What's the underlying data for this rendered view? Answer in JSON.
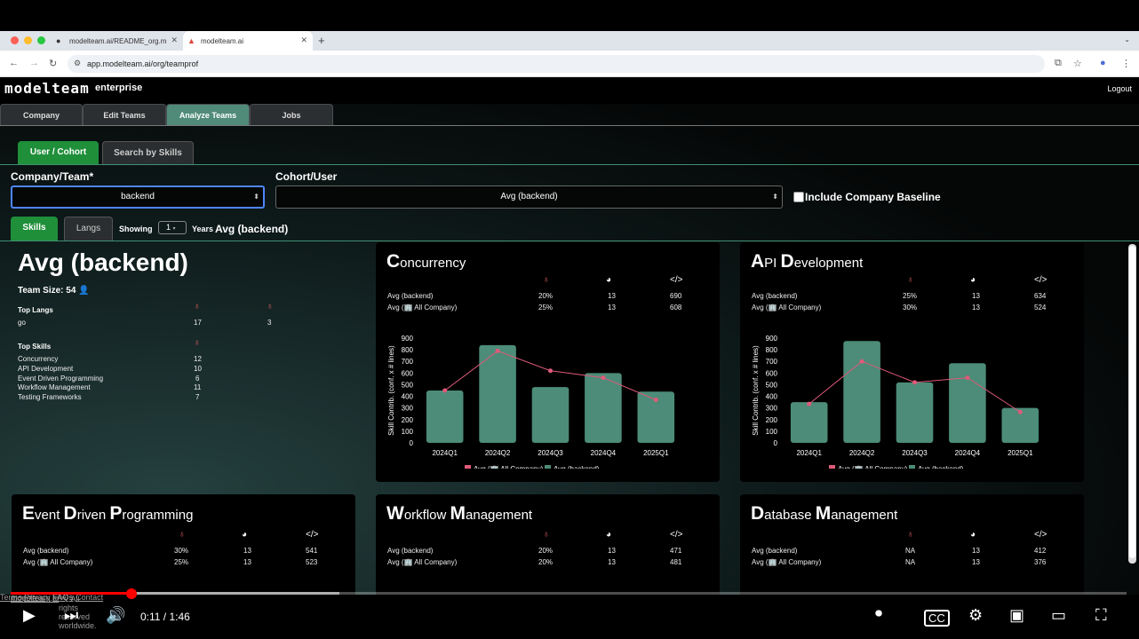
{
  "browser": {
    "tabs": [
      {
        "label": "modelteam.ai/README_org.m"
      },
      {
        "label": "modelteam.ai"
      }
    ],
    "url": "app.modelteam.ai/org/teamprof"
  },
  "app": {
    "logo": "modelteam",
    "edition": "enterprise",
    "logout": "Logout",
    "main_tabs": [
      "Company",
      "Edit Teams",
      "Analyze Teams",
      "Jobs"
    ],
    "sub_tabs": [
      "User / Cohort",
      "Search by Skills"
    ],
    "company_team_label": "Company/Team*",
    "company_team_value": "backend",
    "cohort_label": "Cohort/User",
    "cohort_value": "Avg (backend)",
    "include_baseline": "Include Company Baseline",
    "skill_tabs": [
      "Skills",
      "Langs"
    ],
    "showing_label": "Showing",
    "years_value": "1",
    "years_label": "Years",
    "selection": "Avg (backend)"
  },
  "summary": {
    "title": "Avg (backend)",
    "team_size": "Team Size: 54",
    "top_langs_label": "Top Langs",
    "langs": [
      {
        "name": "go",
        "a": "17",
        "b": "3"
      }
    ],
    "top_skills_label": "Top Skills",
    "skills": [
      {
        "name": "Concurrency",
        "v": "12"
      },
      {
        "name": "API Development",
        "v": "10"
      },
      {
        "name": "Event Driven Programming",
        "v": "6"
      },
      {
        "name": "Workflow Management",
        "v": "11"
      },
      {
        "name": "Testing Frameworks",
        "v": "7"
      }
    ]
  },
  "cards": [
    {
      "cap1": "C",
      "rest1": "oncurrency",
      "cap2": "",
      "rest2": "",
      "rows": [
        {
          "name": "Avg (backend)",
          "a": "20%",
          "b": "13",
          "c": "690"
        },
        {
          "name": "Avg (🏢 All Company)",
          "a": "25%",
          "b": "13",
          "c": "608"
        }
      ]
    },
    {
      "cap1": "A",
      "rest1": "PI ",
      "cap2": "D",
      "rest2": "evelopment",
      "rows": [
        {
          "name": "Avg (backend)",
          "a": "25%",
          "b": "13",
          "c": "634"
        },
        {
          "name": "Avg (🏢 All Company)",
          "a": "30%",
          "b": "13",
          "c": "524"
        }
      ]
    },
    {
      "cap1": "E",
      "rest1": "vent ",
      "cap2": "D",
      "rest2": "riven ",
      "cap3": "P",
      "rest3": "rogramming",
      "rows": [
        {
          "name": "Avg (backend)",
          "a": "30%",
          "b": "13",
          "c": "541"
        },
        {
          "name": "Avg (🏢 All Company)",
          "a": "25%",
          "b": "13",
          "c": "523"
        }
      ]
    },
    {
      "cap1": "W",
      "rest1": "orkflow ",
      "cap2": "M",
      "rest2": "anagement",
      "rows": [
        {
          "name": "Avg (backend)",
          "a": "20%",
          "b": "13",
          "c": "471"
        },
        {
          "name": "Avg (🏢 All Company)",
          "a": "20%",
          "b": "13",
          "c": "481"
        }
      ]
    },
    {
      "cap1": "D",
      "rest1": "atabase ",
      "cap2": "M",
      "rest2": "anagement",
      "rows": [
        {
          "name": "Avg (backend)",
          "a": "NA",
          "b": "13",
          "c": "412"
        },
        {
          "name": "Avg (🏢 All Company)",
          "a": "NA",
          "b": "13",
          "c": "376"
        }
      ]
    }
  ],
  "chart_data": [
    {
      "type": "bar",
      "title": "Concurrency",
      "ylabel": "Skill Contrib. (conf. x # lines)",
      "categories": [
        "2024Q1",
        "2024Q2",
        "2024Q3",
        "2024Q4",
        "2025Q1"
      ],
      "ylim": [
        0,
        900
      ],
      "yticks": [
        0,
        100,
        200,
        300,
        400,
        500,
        600,
        700,
        800,
        900
      ],
      "series": [
        {
          "name": "Avg (backend)",
          "kind": "bar",
          "color": "#4c8c78",
          "values": [
            450,
            840,
            480,
            600,
            440
          ]
        },
        {
          "name": "Avg (🏢 All Company)",
          "kind": "line",
          "color": "#e05a7a",
          "values": [
            450,
            790,
            620,
            560,
            370
          ]
        }
      ]
    },
    {
      "type": "bar",
      "title": "API Development",
      "ylabel": "Skill Contrib. (conf. x # lines)",
      "categories": [
        "2024Q1",
        "2024Q2",
        "2024Q3",
        "2024Q4",
        "2025Q1"
      ],
      "ylim": [
        0,
        900
      ],
      "yticks": [
        0,
        100,
        200,
        300,
        400,
        500,
        600,
        700,
        800,
        900
      ],
      "series": [
        {
          "name": "Avg (backend)",
          "kind": "bar",
          "color": "#4c8c78",
          "values": [
            350,
            875,
            520,
            685,
            300
          ]
        },
        {
          "name": "Avg (🏢 All Company)",
          "kind": "line",
          "color": "#e05a7a",
          "values": [
            335,
            700,
            520,
            560,
            265
          ]
        }
      ]
    }
  ],
  "footer": {
    "copyright_a": "© 2025",
    "copyright_link": "modelteam.ai",
    "copyright_b": "™. All rights reserved worldwide.",
    "links": [
      "Terms",
      "Privacy",
      "FAQs",
      "Contact"
    ]
  },
  "player": {
    "time": "0:11 / 1:46",
    "progress_fraction": 0.11
  }
}
